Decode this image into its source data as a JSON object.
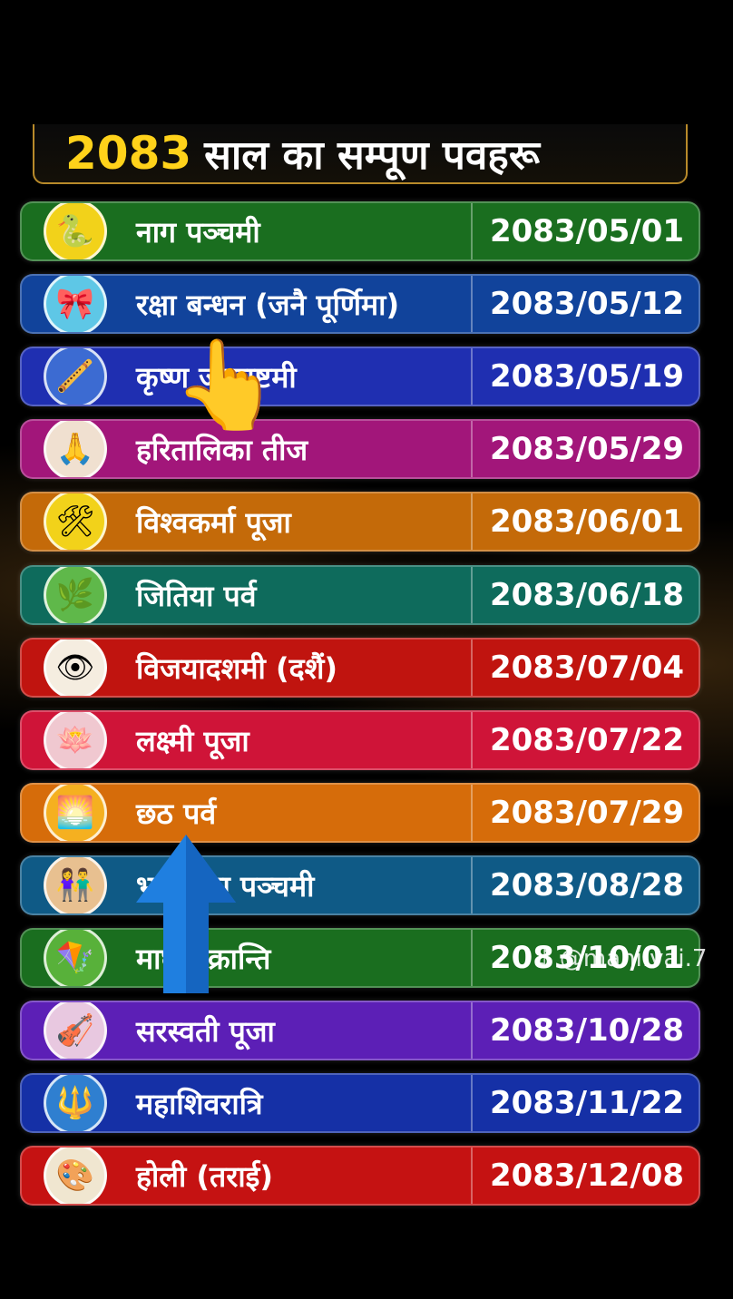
{
  "title": {
    "year": "2083",
    "text": "साल का सम्पूण पवहरू"
  },
  "festivals": [
    {
      "name": "नाग पञ्चमी",
      "date": "2083/05/01",
      "icon": "snake-icon",
      "glyph": "🐍",
      "color": "#1a6e1f",
      "icon_bg": "#f2d21a"
    },
    {
      "name": "रक्षा बन्धन (जनै पूर्णिमा)",
      "date": "2083/05/12",
      "icon": "rakhi-icon",
      "glyph": "🎀",
      "color": "#11439b",
      "icon_bg": "#5ec7e6"
    },
    {
      "name": "कृष्ण जन्माष्टमी",
      "date": "2083/05/19",
      "icon": "krishna-icon",
      "glyph": "🪈",
      "color": "#1f2fb1",
      "icon_bg": "#3c6bd2"
    },
    {
      "name": "हरितालिका तीज",
      "date": "2083/05/29",
      "icon": "woman-praying-icon",
      "glyph": "🙏",
      "color": "#a2167a",
      "icon_bg": "#f0e0d0"
    },
    {
      "name": "विश्वकर्मा पूजा",
      "date": "2083/06/01",
      "icon": "tools-icon",
      "glyph": "🛠",
      "color": "#c46a09",
      "icon_bg": "#f2d21a"
    },
    {
      "name": "जितिया पर्व",
      "date": "2083/06/18",
      "icon": "goddess-icon",
      "glyph": "🌿",
      "color": "#0e6b5c",
      "icon_bg": "#5fb84a"
    },
    {
      "name": "विजयादशमी (दशैं)",
      "date": "2083/07/04",
      "icon": "durga-face-icon",
      "glyph": "👁",
      "color": "#c0140f",
      "icon_bg": "#f5ede0"
    },
    {
      "name": "लक्ष्मी पूजा",
      "date": "2083/07/22",
      "icon": "lakshmi-icon",
      "glyph": "🪷",
      "color": "#cf1438",
      "icon_bg": "#f0c8d0"
    },
    {
      "name": "छठ पर्व",
      "date": "2083/07/29",
      "icon": "sunrise-icon",
      "glyph": "🌅",
      "color": "#d66c0a",
      "icon_bg": "#f5b020"
    },
    {
      "name": "भाइटीका पञ्चमी",
      "date": "2083/08/28",
      "icon": "couple-icon",
      "glyph": "👫",
      "color": "#0f5a86",
      "icon_bg": "#e8c090"
    },
    {
      "name": "माघे संक्रान्ति",
      "date": "2083/10/01",
      "icon": "kite-icon",
      "glyph": "🪁",
      "color": "#1a6e1f",
      "icon_bg": "#58b13a"
    },
    {
      "name": "सरस्वती पूजा",
      "date": "2083/10/28",
      "icon": "saraswati-icon",
      "glyph": "🎻",
      "color": "#5c1fb6",
      "icon_bg": "#e8c8e0"
    },
    {
      "name": "महाशिवरात्रि",
      "date": "2083/11/22",
      "icon": "shiva-icon",
      "glyph": "🔱",
      "color": "#1530a6",
      "icon_bg": "#2f7fd0"
    },
    {
      "name": "होली (तराई)",
      "date": "2083/12/08",
      "icon": "holi-colors-icon",
      "glyph": "🎨",
      "color": "#c51212",
      "icon_bg": "#f0e6d0"
    }
  ],
  "overlays": {
    "hand_icon": "pointing-hand-icon",
    "arrow_icon": "up-arrow-icon",
    "watermark": "@mahi.vai.7"
  }
}
